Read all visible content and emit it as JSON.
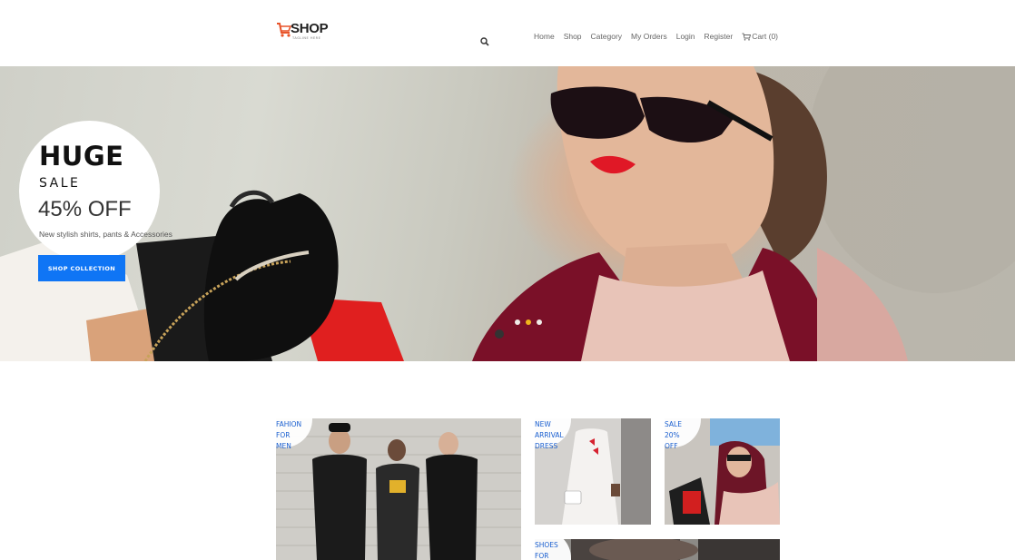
{
  "brand": {
    "name": "SHOP",
    "tagline": "TAGLINE HERE"
  },
  "nav": {
    "items": [
      "Home",
      "Shop",
      "Category",
      "My Orders",
      "Login",
      "Register"
    ],
    "cart_label": "Cart (0)"
  },
  "hero": {
    "title": "HUGE",
    "subtitle": "SALE",
    "offer": "45% OFF",
    "description": "New stylish shirts, pants & Accessories",
    "button_label": "SHOP COLLECTION",
    "slides_total": 3,
    "active_slide": 2
  },
  "categories": [
    {
      "label": "FAHION\nFOR\nMEN"
    },
    {
      "label": "NEW\nARRIVAL\nDRESS"
    },
    {
      "label": "SALE\n20%\nOFF"
    },
    {
      "label": "SHOES\nFOR"
    }
  ],
  "colors": {
    "accent": "#0f75f5",
    "dot_active": "#f0b41c",
    "tile_text": "#1a5fd0",
    "logo_cart": "#e8542a"
  }
}
